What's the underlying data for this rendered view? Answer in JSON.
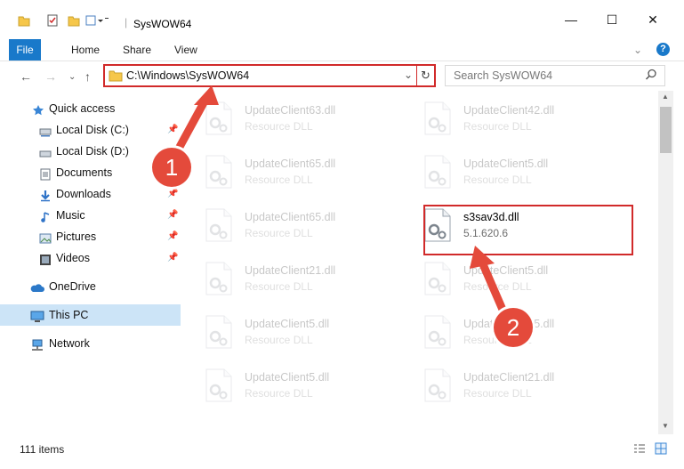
{
  "window": {
    "title": "SysWOW64",
    "minimize": "—",
    "maximize": "☐",
    "close": "✕"
  },
  "ribbon": {
    "tabs": [
      "File",
      "Home",
      "Share",
      "View"
    ],
    "help": "?"
  },
  "nav": {
    "address": "C:\\Windows\\SysWOW64",
    "search_placeholder": "Search SysWOW64"
  },
  "sidebar": {
    "items": [
      {
        "label": "Quick access",
        "icon": "star-icon",
        "pinned": false
      },
      {
        "label": "Local Disk (C:)",
        "icon": "drive-icon",
        "pinned": true
      },
      {
        "label": "Local Disk (D:)",
        "icon": "drive-icon",
        "pinned": false
      },
      {
        "label": "Documents",
        "icon": "documents-icon",
        "pinned": true
      },
      {
        "label": "Downloads",
        "icon": "download-icon",
        "pinned": true
      },
      {
        "label": "Music",
        "icon": "music-icon",
        "pinned": true
      },
      {
        "label": "Pictures",
        "icon": "pictures-icon",
        "pinned": true
      },
      {
        "label": "Videos",
        "icon": "videos-icon",
        "pinned": true
      },
      {
        "label": "OneDrive",
        "icon": "cloud-icon",
        "pinned": false
      },
      {
        "label": "This PC",
        "icon": "computer-icon",
        "pinned": false,
        "selected": true
      },
      {
        "label": "Network",
        "icon": "network-icon",
        "pinned": false
      }
    ]
  },
  "files": [
    {
      "name": "UpdateClient63.dll",
      "desc": "Resource DLL",
      "faded": true
    },
    {
      "name": "UpdateClient42.dll",
      "desc": "Resource DLL",
      "faded": true
    },
    {
      "name": "UpdateClient65.dll",
      "desc": "Resource DLL",
      "faded": true
    },
    {
      "name": "UpdateClient5.dll",
      "desc": "Resource DLL",
      "faded": true
    },
    {
      "name": "UpdateClient65.dll",
      "desc": "Resource DLL",
      "faded": true
    },
    {
      "name": "s3sav3d.dll",
      "desc": "5.1.620.6",
      "faded": false
    },
    {
      "name": "UpdateClient21.dll",
      "desc": "Resource DLL",
      "faded": true
    },
    {
      "name": "UpdateClient5.dll",
      "desc": "Resource DLL",
      "faded": true
    },
    {
      "name": "UpdateClient5.dll",
      "desc": "Resource DLL",
      "faded": true
    },
    {
      "name": "UpdateClient65.dll",
      "desc": "Resource DLL",
      "faded": true
    },
    {
      "name": "UpdateClient5.dll",
      "desc": "Resource DLL",
      "faded": true
    },
    {
      "name": "UpdateClient21.dll",
      "desc": "Resource DLL",
      "faded": true
    }
  ],
  "status": {
    "item_count": "111 items"
  },
  "annotations": {
    "step1": "1",
    "step2": "2",
    "color": "#e44a3b"
  },
  "colors": {
    "accent": "#1979ca",
    "selection": "#cce4f7",
    "highlight_border": "#d12a2a"
  }
}
